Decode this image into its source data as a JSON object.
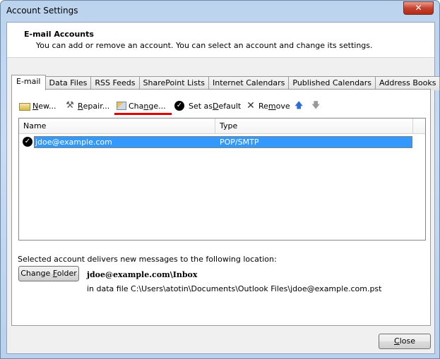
{
  "window": {
    "title": "Account Settings",
    "close_glyph": "✕"
  },
  "header": {
    "title": "E-mail Accounts",
    "description": "You can add or remove an account. You can select an account and change its settings."
  },
  "tabs": [
    {
      "label": "E-mail",
      "active": true
    },
    {
      "label": "Data Files"
    },
    {
      "label": "RSS Feeds"
    },
    {
      "label": "SharePoint Lists"
    },
    {
      "label": "Internet Calendars"
    },
    {
      "label": "Published Calendars"
    },
    {
      "label": "Address Books"
    }
  ],
  "toolbar": {
    "new": {
      "pre": "",
      "key": "N",
      "post": "ew..."
    },
    "repair": {
      "pre": "",
      "key": "R",
      "post": "epair..."
    },
    "change": {
      "pre": "Cha",
      "key": "n",
      "post": "ge..."
    },
    "set_default": {
      "pre": "Set as ",
      "key": "D",
      "post": "efault"
    },
    "remove": {
      "pre": "Re",
      "key": "m",
      "post": "ove"
    },
    "highlight_color": "#e00000"
  },
  "list": {
    "columns": [
      "Name",
      "Type"
    ],
    "rows": [
      {
        "name": "jdoe@example.com",
        "type": "POP/SMTP",
        "default": true,
        "selected": true
      }
    ]
  },
  "delivery": {
    "label": "Selected account delivers new messages to the following location:",
    "change_folder": {
      "pre": "Change ",
      "key": "F",
      "post": "older"
    },
    "folder": "jdoe@example.com\\Inbox",
    "data_file": "in data file C:\\Users\\atotin\\Documents\\Outlook Files\\jdoe@example.com.pst"
  },
  "footer": {
    "close": {
      "key": "C",
      "post": "lose"
    }
  }
}
